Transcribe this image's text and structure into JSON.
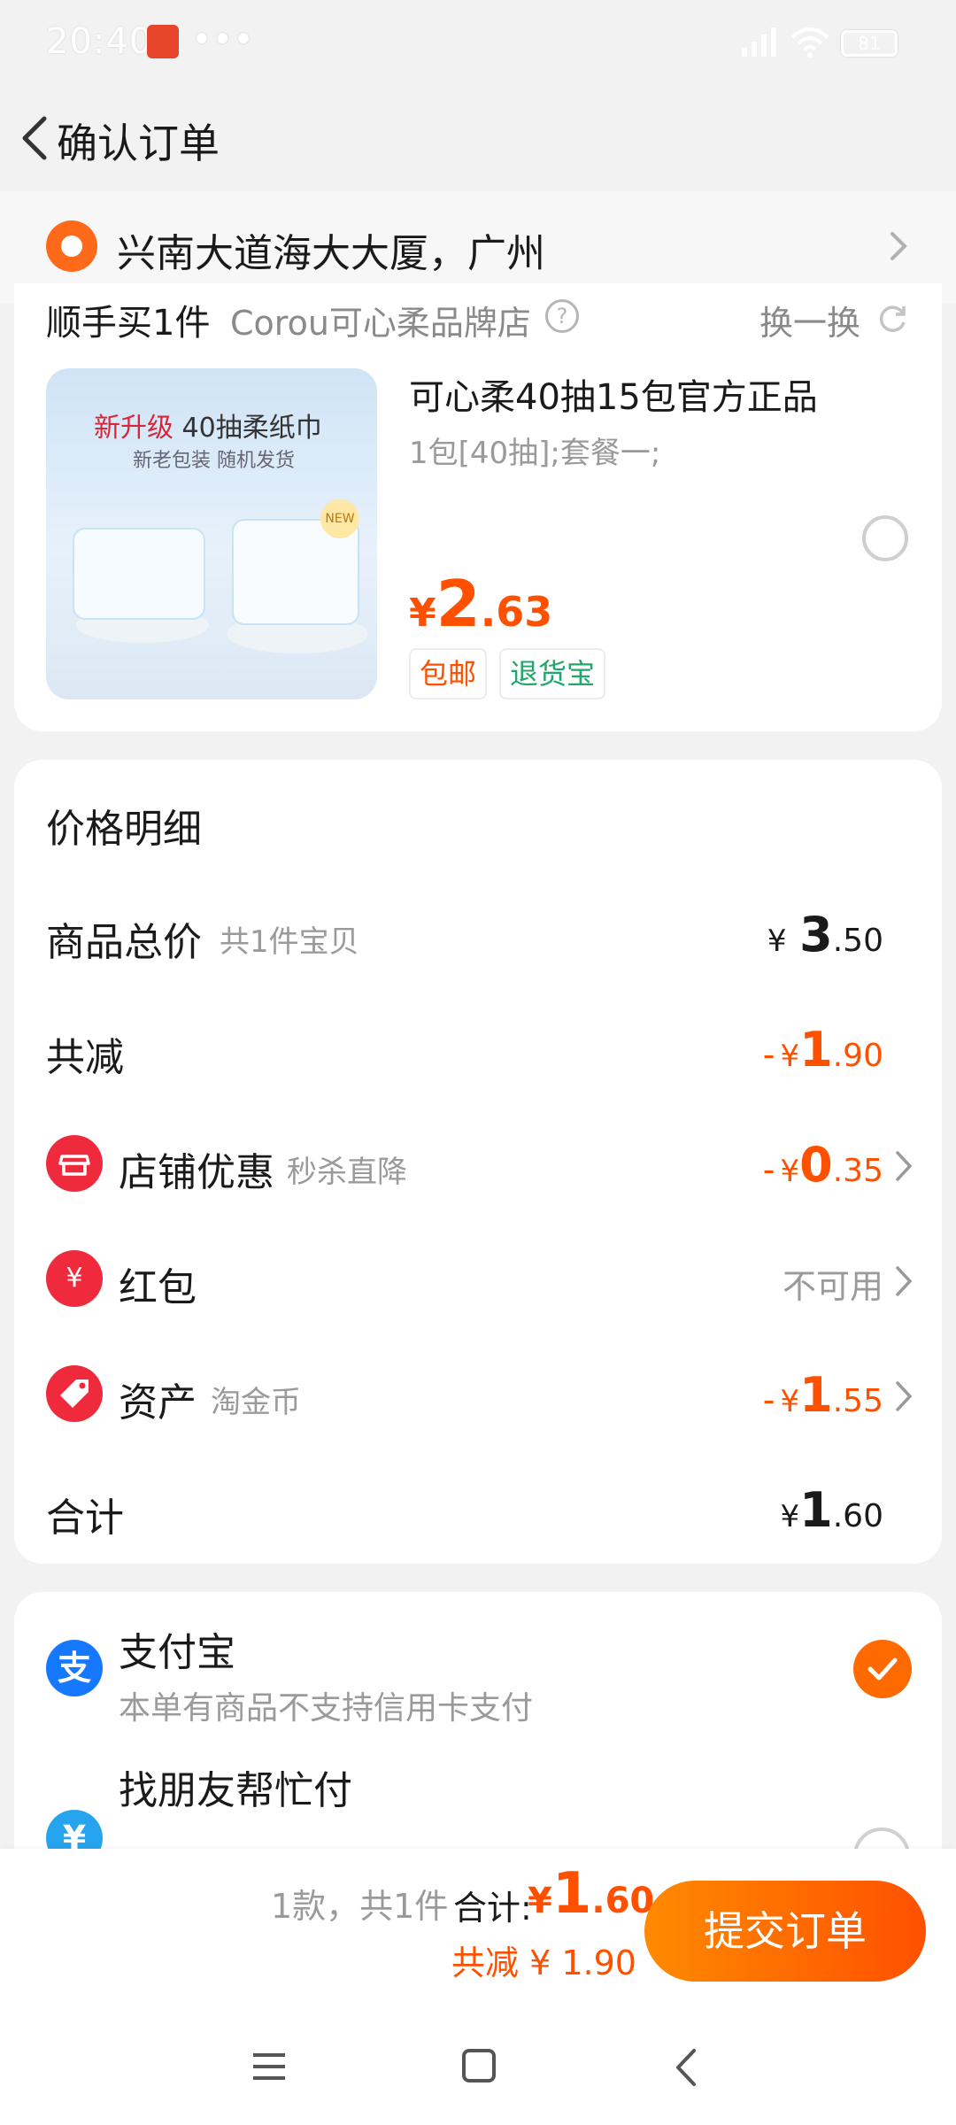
{
  "status_bar": {
    "time": "20:40",
    "battery": "81"
  },
  "header": {
    "title": "确认订单"
  },
  "address": {
    "text": "兴南大道海大大厦，广州"
  },
  "addon": {
    "heading": "顺手买1件",
    "store": "Corou可心柔品牌店",
    "help_glyph": "?",
    "swap_label": "换一换",
    "product": {
      "image_slogan_new": "新升级",
      "image_slogan_rest": " 40抽柔纸巾",
      "image_sub": "新老包装 随机发货",
      "image_badge": "NEW",
      "name": "可心柔40抽15包官方正品",
      "spec": "1包[40抽];套餐一;",
      "price_currency": "¥",
      "price_int": "2",
      "price_dec": ".63",
      "tag_shipping": "包邮",
      "tag_return": "退货宝"
    }
  },
  "price_detail": {
    "title": "价格明细",
    "goods_total": {
      "label": "商品总价",
      "hint": "共1件宝贝",
      "currency": "¥",
      "int": "3",
      "dec": ".50"
    },
    "reduction": {
      "label": "共减",
      "minus": "-",
      "currency": "¥",
      "int": "1",
      "dec": ".90"
    },
    "store_discount": {
      "label": "店铺优惠",
      "hint": "秒杀直降",
      "minus": "-",
      "currency": "¥",
      "int": "0",
      "dec": ".35"
    },
    "red_packet": {
      "label": "红包",
      "icon_glyph": "¥",
      "value": "不可用"
    },
    "assets": {
      "label": "资产",
      "hint": "淘金币",
      "minus": "-",
      "currency": "¥",
      "int": "1",
      "dec": ".55"
    },
    "total": {
      "label": "合计",
      "currency": "¥",
      "int": "1",
      "dec": ".60"
    }
  },
  "payment": {
    "alipay": {
      "name": "支付宝",
      "desc": "本单有商品不支持信用卡支付",
      "logo_glyph": "支",
      "selected": true
    },
    "friend_pay": {
      "name": "找朋友帮忙付",
      "logo_glyph": "¥",
      "selected": false
    }
  },
  "bottom_bar": {
    "count": "1款，共1件",
    "total_label": "合计:",
    "total_currency": "¥",
    "total_int": "1",
    "total_dec": ".60",
    "saved": "共减 ¥ 1.90",
    "submit": "提交订单"
  },
  "colors": {
    "accent": "#ff5000",
    "alipay_blue": "#1677ff",
    "coupon_red": "#ee2a3c"
  }
}
